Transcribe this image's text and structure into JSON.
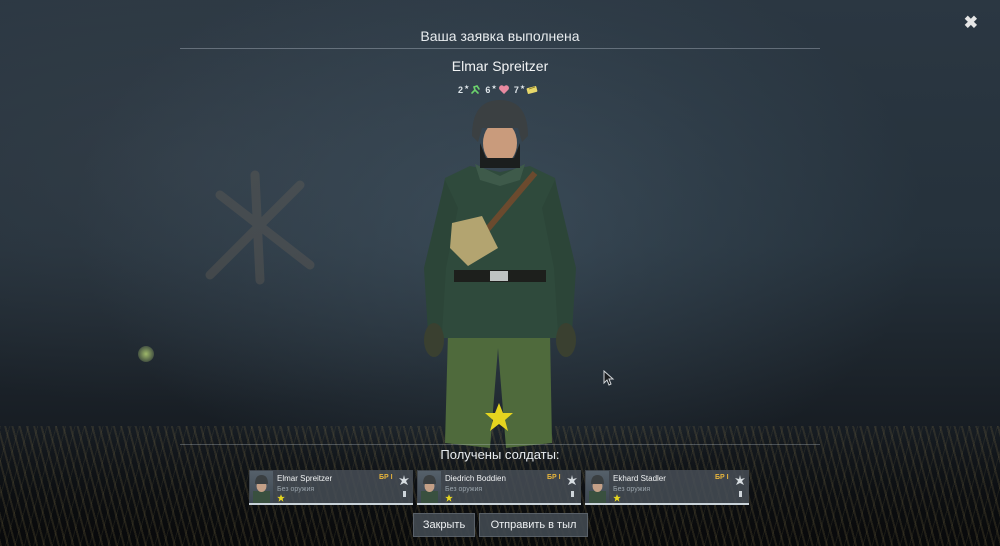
{
  "dialog": {
    "title": "Ваша заявка выполнена",
    "soldier_name": "Elmar Spreitzer",
    "perks": [
      {
        "value": "2",
        "icon": "agility-icon",
        "color": "#6cd26c"
      },
      {
        "value": "6",
        "icon": "heart-icon",
        "color": "#e88aa0"
      },
      {
        "value": "7",
        "icon": "ammo-pouch-icon",
        "color": "#e8d86a"
      }
    ],
    "received_label": "Получены солдаты:",
    "close_icon": "close-icon"
  },
  "soldiers": [
    {
      "name": "Elmar Spreitzer",
      "weapon": "Без оружия",
      "br": "БР I",
      "class_icon": "assault-class-icon",
      "rank": "star-icon"
    },
    {
      "name": "Diedrich Boddien",
      "weapon": "Без оружия",
      "br": "БР I",
      "class_icon": "assault-class-icon",
      "rank": "star-icon"
    },
    {
      "name": "Ekhard Stadler",
      "weapon": "Без оружия",
      "br": "БР I",
      "class_icon": "assault-class-icon",
      "rank": "star-icon"
    }
  ],
  "buttons": {
    "close_label": "Закрыть",
    "send_back_label": "Отправить в тыл"
  },
  "colors": {
    "accent_star": "#e5d51f",
    "br_text": "#e6b43c"
  }
}
